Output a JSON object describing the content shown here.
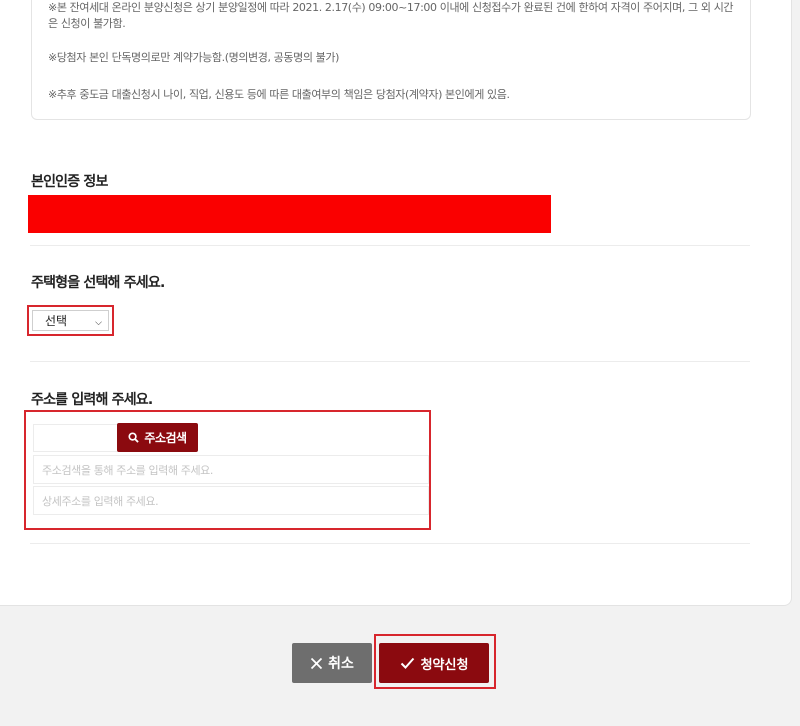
{
  "notices": [
    "※본 잔여세대 온라인 분양신청은 상기 분양일정에 따라 2021. 2.17(수) 09:00~17:00 이내에 신청접수가 완료된 건에 한하여 자격이 주어지며, 그 외 시간은 신청이 불가함.",
    "※당첨자 본인 단독명의로만 계약가능함.(명의변경, 공동명의 불가)",
    "※추후 중도금 대출신청시 나이, 직업, 신용도 등에 따른 대출여부의 책임은 당첨자(계약자) 본인에게 있음."
  ],
  "identity": {
    "title": "본인인증 정보"
  },
  "housing": {
    "title": "주택형을 선택해 주세요.",
    "select_value": "선택"
  },
  "address": {
    "title": "주소를 입력해 주세요.",
    "search_label": "주소검색",
    "address_placeholder": "주소검색을 통해 주소를 입력해 주세요.",
    "detail_placeholder": "상세주소를 입력해 주세요."
  },
  "actions": {
    "cancel_label": "취소",
    "apply_label": "청약신청"
  },
  "colors": {
    "accent": "#8b0a0f",
    "highlight": "#d7262d",
    "redaction": "#fa0000",
    "cancel": "#6e6e6e"
  }
}
